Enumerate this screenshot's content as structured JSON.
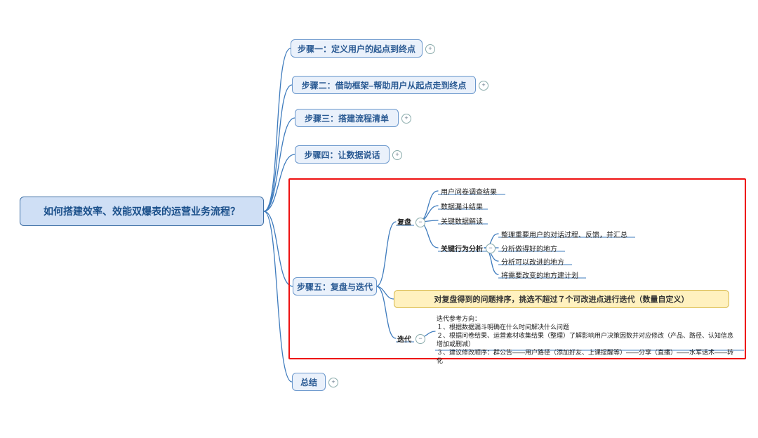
{
  "root": {
    "title": "如何搭建效率、效能双爆表的运营业务流程？"
  },
  "steps": {
    "s1": "步骤一：定义用户的起点到终点",
    "s2": "步骤二：借助框架–帮助用户从起点走到终点",
    "s3": "步骤三：搭建流程清单",
    "s4": "步骤四：让数据说话",
    "s5": "步骤五：复盘与迭代",
    "s6": "总结"
  },
  "fupan": {
    "label": "复盘",
    "items": [
      "用户问卷调查结果",
      "数据漏斗结果",
      "关键数据解读"
    ],
    "analysis_label": "关键行为分析",
    "analysis": [
      "整理重要用户的对话过程、反馈，并汇总",
      "分析做得好的地方",
      "分析可以改进的地方",
      "将需要改变的地方建计划"
    ]
  },
  "highlight": "对复盘得到的问题排序，挑选不超过７个可改进点进行迭代（数量自定义）",
  "diedai": {
    "label": "迭代",
    "title": "迭代参考方向：",
    "lines": [
      "１、根据数据漏斗明确在什么时间解决什么问题",
      "２、根据问卷结果、运营素材收集结果（整理）了解影响用户决策因数并对应修改（产品、路径、认知信息增加或删减）",
      "３、建议修改顺序：群公告——用户路径（添加好友、上课提醒等）——分享（直播）——水军话术——转化"
    ]
  }
}
